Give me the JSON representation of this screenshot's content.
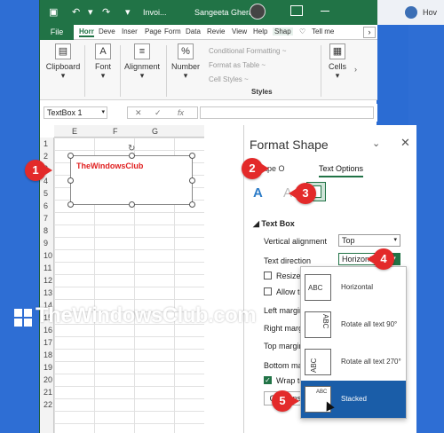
{
  "window": {
    "doc_name": "Invoi...",
    "user_name": "Sangeeta Ghera",
    "tabs": [
      "File",
      "Horr",
      "Deve",
      "Inser",
      "Page",
      "Form",
      "Data",
      "Revie",
      "View",
      "Help",
      "Shap"
    ],
    "tell_me": "Tell me"
  },
  "background_tab": {
    "label": "Hov"
  },
  "ribbon": {
    "clipboard": "Clipboard",
    "font": "Font",
    "alignment": "Alignment",
    "number": "Number",
    "cond_format": "Conditional Formatting ~",
    "format_table": "Format as Table ~",
    "cell_styles": "Cell Styles ~",
    "styles_group": "Styles",
    "cells": "Cells"
  },
  "formula_bar": {
    "name_box": "TextBox 1",
    "fx": "fx"
  },
  "grid": {
    "columns": [
      "E",
      "F",
      "G"
    ],
    "rows": [
      "1",
      "2",
      "3",
      "4",
      "5",
      "6",
      "7",
      "8",
      "9",
      "10",
      "11",
      "12",
      "13",
      "14",
      "15",
      "16",
      "17",
      "18",
      "19",
      "20",
      "21",
      "22"
    ],
    "textbox_text": "TheWindowsClub"
  },
  "watermark": "TheWindowsClub.com",
  "pane": {
    "title": "Format Shape",
    "tab_shape": "Shape O",
    "tab_text": "Text Options",
    "section": "Text Box",
    "vertical_alignment_label": "Vertical alignment",
    "vertical_alignment_value": "Top",
    "text_direction_label": "Text direction",
    "text_direction_value": "Horizontal",
    "resize_label": "Resize shape to fit",
    "overflow_label": "Allow text to overfl",
    "left_margin": "Left margin",
    "right_margin": "Right margin",
    "top_margin": "Top margin",
    "bottom_margin": "Bottom margin",
    "wrap_label": "Wrap text in shape",
    "columns_button": "Columns..."
  },
  "dropdown": {
    "items": [
      {
        "label": "Horizontal",
        "preview": "ABC"
      },
      {
        "label": "Rotate all text 90°",
        "preview": "ABC"
      },
      {
        "label": "Rotate all text 270°",
        "preview": "ABC"
      },
      {
        "label": "Stacked",
        "preview": "ABC"
      }
    ],
    "selected": "Stacked"
  },
  "callouts": [
    "1",
    "2",
    "3",
    "4",
    "5"
  ],
  "colors": {
    "excel_green": "#217346",
    "callout_red": "#e32a2a",
    "selected_blue": "#1a5da8",
    "background_blue": "#2e6ed4"
  }
}
